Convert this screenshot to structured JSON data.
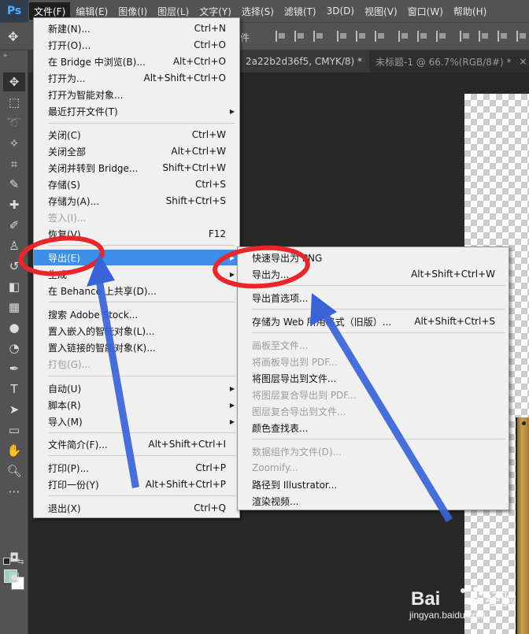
{
  "app": {
    "logo": "Ps"
  },
  "menubar": [
    {
      "label": "文件(F)",
      "active": true
    },
    {
      "label": "编辑(E)"
    },
    {
      "label": "图像(I)"
    },
    {
      "label": "图层(L)"
    },
    {
      "label": "文字(Y)"
    },
    {
      "label": "选择(S)"
    },
    {
      "label": "滤镜(T)"
    },
    {
      "label": "3D(D)"
    },
    {
      "label": "视图(V)"
    },
    {
      "label": "窗口(W)"
    },
    {
      "label": "帮助(H)"
    }
  ],
  "options_bar": {
    "partial_text": "件"
  },
  "tabs": [
    {
      "label": "2a22b2d36f5, CMYK/8) *",
      "close": "×"
    },
    {
      "label": "未标题-1 @ 66.7%(RGB/8#) *",
      "close": "×"
    }
  ],
  "toolbar": {
    "collapse": "»",
    "swap": "⇆"
  },
  "file_menu": [
    {
      "label": "新建(N)...",
      "shortcut": "Ctrl+N"
    },
    {
      "label": "打开(O)...",
      "shortcut": "Ctrl+O"
    },
    {
      "label": "在 Bridge 中浏览(B)...",
      "shortcut": "Alt+Ctrl+O"
    },
    {
      "label": "打开为...",
      "shortcut": "Alt+Shift+Ctrl+O"
    },
    {
      "label": "打开为智能对象...",
      "shortcut": ""
    },
    {
      "label": "最近打开文件(T)",
      "shortcut": "",
      "arrow": "▶"
    },
    {
      "label": "关闭(C)",
      "shortcut": "Ctrl+W"
    },
    {
      "label": "关闭全部",
      "shortcut": "Alt+Ctrl+W"
    },
    {
      "label": "关闭并转到 Bridge...",
      "shortcut": "Shift+Ctrl+W"
    },
    {
      "label": "存储(S)",
      "shortcut": "Ctrl+S"
    },
    {
      "label": "存储为(A)...",
      "shortcut": "Shift+Ctrl+S"
    },
    {
      "label": "签入(I)...",
      "shortcut": "",
      "disabled": true
    },
    {
      "label": "恢复(V)",
      "shortcut": "F12"
    },
    {
      "label": "导出(E)",
      "shortcut": "",
      "arrow": "▶",
      "highlighted": true
    },
    {
      "label": "生成",
      "shortcut": "",
      "arrow": "▶"
    },
    {
      "label": "在 Behance 上共享(D)...",
      "shortcut": ""
    },
    {
      "label": "搜索 Adobe Stock...",
      "shortcut": ""
    },
    {
      "label": "置入嵌入的智能对象(L)...",
      "shortcut": ""
    },
    {
      "label": "置入链接的智能对象(K)...",
      "shortcut": ""
    },
    {
      "label": "打包(G)...",
      "shortcut": "",
      "disabled": true
    },
    {
      "label": "自动(U)",
      "shortcut": "",
      "arrow": "▶"
    },
    {
      "label": "脚本(R)",
      "shortcut": "",
      "arrow": "▶"
    },
    {
      "label": "导入(M)",
      "shortcut": "",
      "arrow": "▶"
    },
    {
      "label": "文件简介(F)...",
      "shortcut": "Alt+Shift+Ctrl+I"
    },
    {
      "label": "打印(P)...",
      "shortcut": "Ctrl+P"
    },
    {
      "label": "打印一份(Y)",
      "shortcut": "Alt+Shift+Ctrl+P"
    },
    {
      "label": "退出(X)",
      "shortcut": "Ctrl+Q"
    }
  ],
  "export_menu": [
    {
      "label": "快速导出为 PNG",
      "shortcut": ""
    },
    {
      "label": "导出为...",
      "shortcut": "Alt+Shift+Ctrl+W"
    },
    {
      "label": "导出首选项...",
      "shortcut": ""
    },
    {
      "label": "存储为 Web 所用格式（旧版）...",
      "shortcut": "Alt+Shift+Ctrl+S"
    },
    {
      "label": "画板至文件...",
      "shortcut": "",
      "disabled": true
    },
    {
      "label": "将画板导出到 PDF...",
      "shortcut": "",
      "disabled": true
    },
    {
      "label": "将图层导出到文件...",
      "shortcut": ""
    },
    {
      "label": "将图层复合导出到 PDF...",
      "shortcut": "",
      "disabled": true
    },
    {
      "label": "图层复合导出到文件...",
      "shortcut": "",
      "disabled": true
    },
    {
      "label": "颜色查找表...",
      "shortcut": ""
    },
    {
      "label": "数据组作为文件(D)...",
      "shortcut": "",
      "disabled": true
    },
    {
      "label": "Zoomify...",
      "shortcut": "",
      "disabled": true
    },
    {
      "label": "路径到 Illustrator...",
      "shortcut": ""
    },
    {
      "label": "渲染视频...",
      "shortcut": ""
    }
  ],
  "colors": {
    "highlight": "#3c8ee8",
    "annotation_red": "#e8262b",
    "annotation_blue": "#3a63d8",
    "foreground_swatch": "#9fd0bb"
  },
  "watermark": {
    "text": "jingyan.baidu.com"
  }
}
